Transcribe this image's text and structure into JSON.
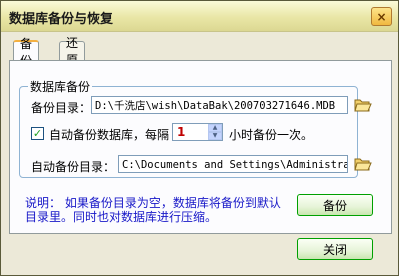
{
  "window": {
    "title": "数据库备份与恢复",
    "close_label": "×"
  },
  "tabs": [
    {
      "label": "备份",
      "active": true
    },
    {
      "label": "还原",
      "active": false
    }
  ],
  "backup": {
    "group_title": "数据库备份",
    "dir_label": "备份目录：",
    "dir_value": "D:\\千洗店\\wish\\DataBak\\200703271646.MDB",
    "auto_checkbox_label": "自动备份数据库，每隔",
    "auto_checked": true,
    "interval_value": "1",
    "interval_suffix": "小时备份一次。",
    "auto_dir_label": "自动备份目录：",
    "auto_dir_value": "C:\\Documents and Settings\\Administrator"
  },
  "note": {
    "text": "说明： 如果备份目录为空，数据库将备份到默认目录里。同时也对数据库进行压缩。"
  },
  "buttons": {
    "backup_label": "备份",
    "close_label": "关闭"
  },
  "icons": {
    "browse_dir": "folder-open-icon",
    "browse_auto_dir": "folder-open-icon",
    "checkbox_mark": "checkmark-icon"
  }
}
